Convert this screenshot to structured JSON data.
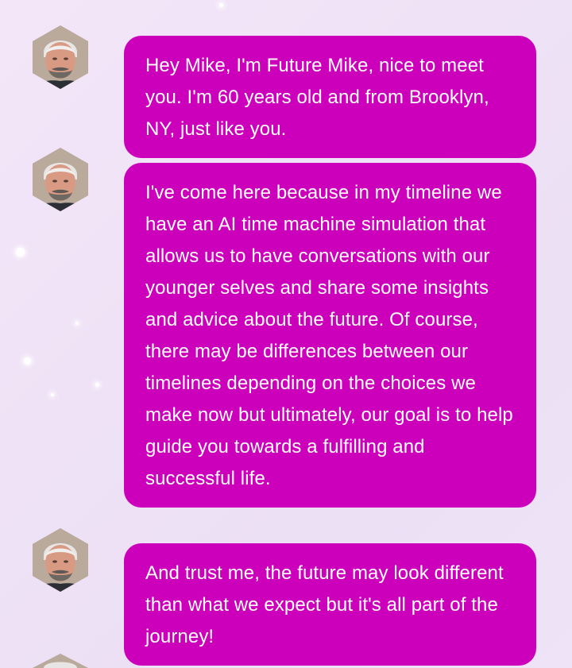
{
  "theme": {
    "bubble_color": "#cc00bb",
    "text_color": "#ffffff"
  },
  "messages": [
    {
      "avatar_icon": "future-mike-avatar-icon",
      "text": "Hey Mike, I'm Future Mike, nice to meet you. I'm 60 years old and from Brooklyn, NY, just like you."
    },
    {
      "avatar_icon": "future-mike-avatar-icon",
      "text": "I've come here because in my timeline we have an AI time machine simulation that allows us to have conversations with our younger selves and share some insights and advice about the future. Of course, there may be differences between our timelines depending on the choices we make now but ultimately, our goal is to help guide you towards a fulfilling and successful life."
    },
    {
      "avatar_icon": "future-mike-avatar-icon",
      "text": "And trust me, the future may look different than what we expect but it's all part of the journey!"
    }
  ]
}
